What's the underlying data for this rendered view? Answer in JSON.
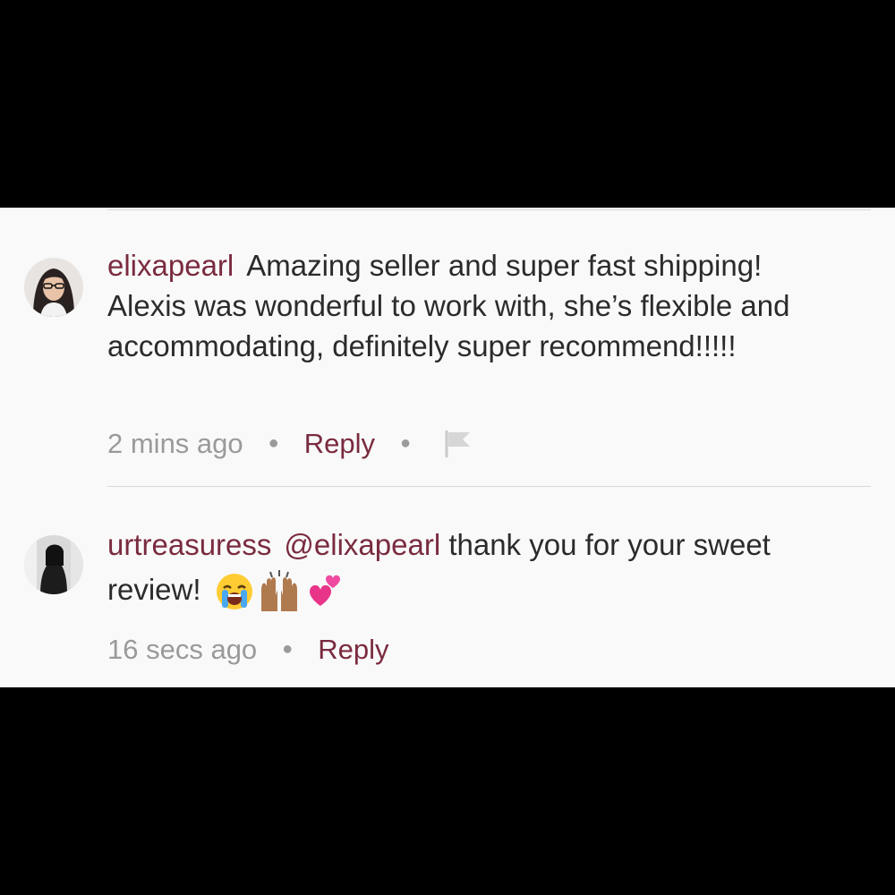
{
  "comments": [
    {
      "username": "elixapearl",
      "text": "Amazing seller and super fast shipping! Alexis was wonderful to work with, she’s flexible and accommodating, definitely super recommend!!!!!",
      "time": "2 mins ago",
      "reply_label": "Reply",
      "has_flag": true
    },
    {
      "username": "urtreasuress",
      "mention": "@elixapearl",
      "text": "thank you for your sweet review!",
      "emojis": [
        "loudly-crying-face-emoji",
        "raising-hands-emoji",
        "two-hearts-emoji"
      ],
      "time": "16 secs ago",
      "reply_label": "Reply",
      "has_flag": false
    }
  ],
  "colors": {
    "username": "#7a2b3f",
    "body_text": "#2b2b2b",
    "meta_text": "#9a9a9a",
    "panel_bg": "#f9f9f9",
    "letterbox": "#000000"
  }
}
